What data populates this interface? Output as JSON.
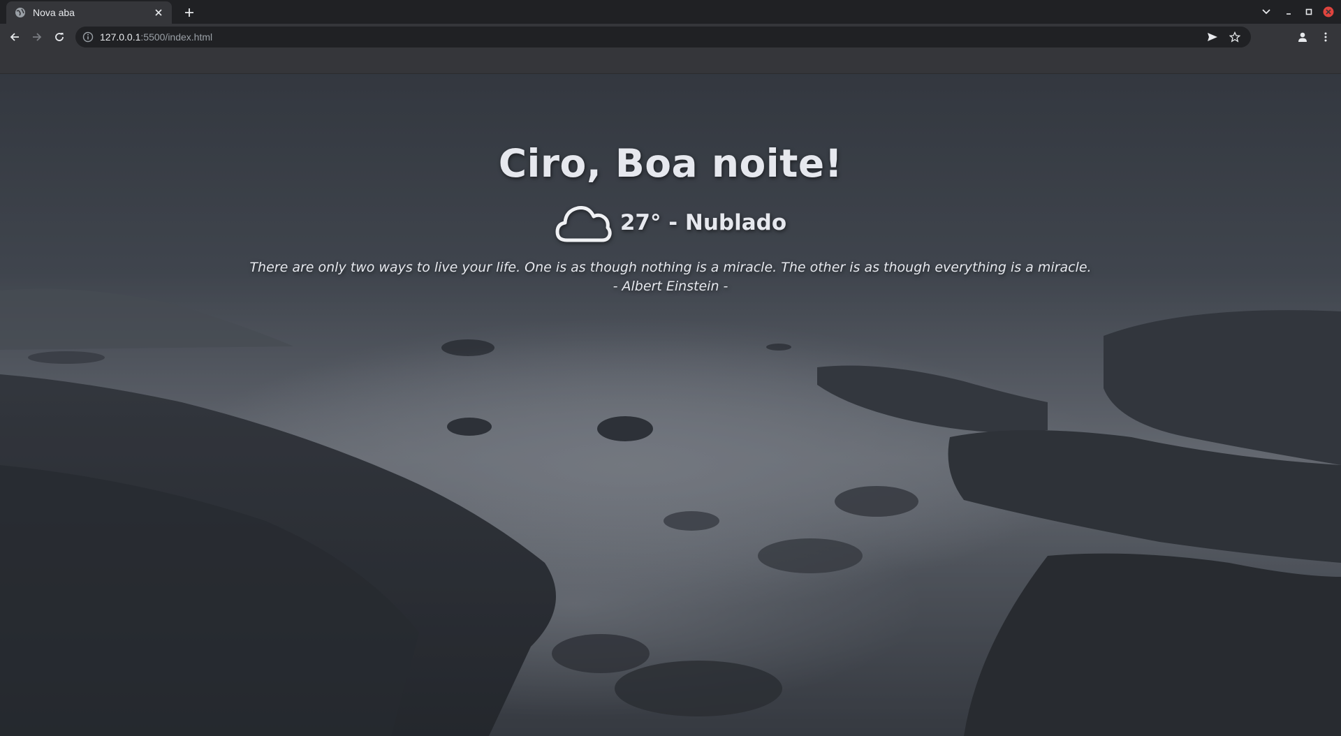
{
  "browser": {
    "tab": {
      "title": "Nova aba",
      "favicon": "globe-icon"
    },
    "omnibox": {
      "host": "127.0.0.1",
      "path": ":5500/index.html"
    }
  },
  "page": {
    "greeting": "Ciro, Boa noite!",
    "weather": {
      "icon": "cloud-icon",
      "text": "27° - Nublado"
    },
    "quote": {
      "text": "There are only two ways to live your life. One is as though nothing is a miracle. The other is as though everything is a miracle.",
      "author": "- Albert Einstein -"
    }
  },
  "colors": {
    "chrome_dark": "#202124",
    "chrome_toolbar": "#35363a",
    "text_light": "#e6e8ee",
    "close_red": "#e0443e"
  }
}
